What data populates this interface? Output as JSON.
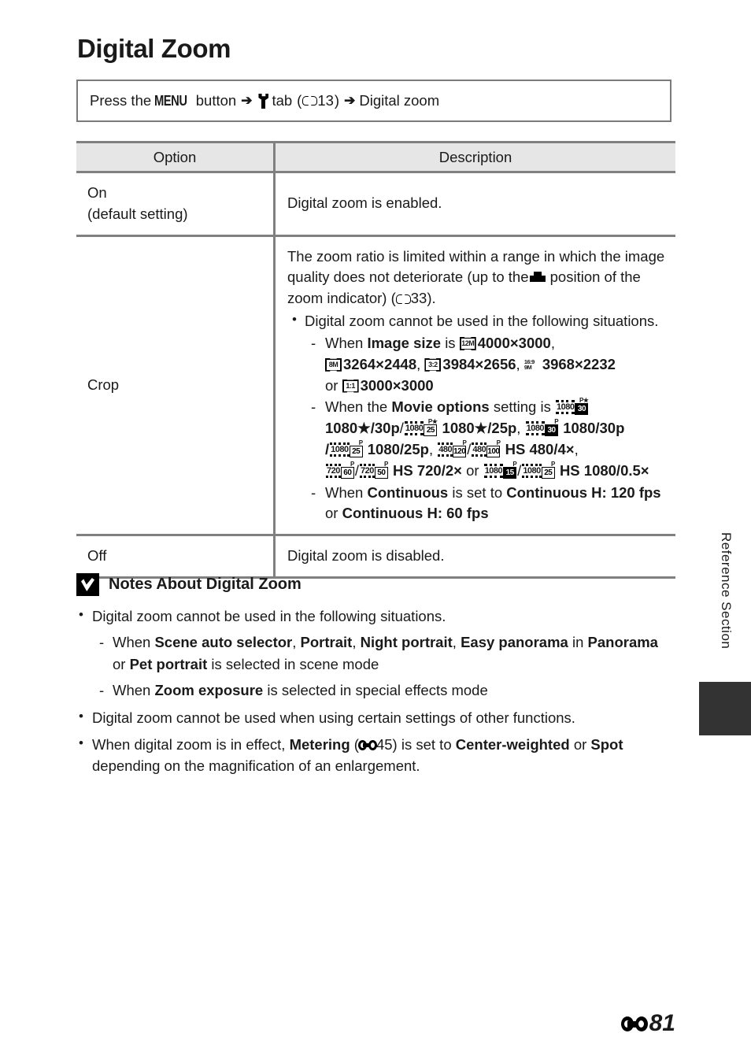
{
  "page": {
    "title": "Digital Zoom",
    "footer_page_number": "81",
    "side_tab_label": "Reference Section"
  },
  "menu_path": {
    "press_the": "Press the",
    "menu_button_label": "MENU",
    "button_word": "button",
    "tab_word": "tab",
    "tab_ref_page": "13",
    "open_paren": "(",
    "close_paren": ")",
    "destination": "Digital zoom",
    "arrow": "➔"
  },
  "table": {
    "headers": {
      "option": "Option",
      "description": "Description"
    },
    "rows": [
      {
        "option_line1": "On",
        "option_line2": "(default setting)",
        "description": "Digital zoom is enabled."
      },
      {
        "option": "Crop",
        "intro_part1": "The zoom ratio is limited within a range in which the image quality does not deteriorate (up to the",
        "intro_part2": "position of the zoom indicator) (",
        "intro_ref_page": "33",
        "intro_part3": ").",
        "bullet": "Digital zoom cannot be used in the following situations.",
        "sub_items": [
          {
            "prefix": "When",
            "bold_term": "Image size",
            "mid": "is",
            "sizes": [
              {
                "icon": "12M",
                "value": "4000×3000"
              },
              {
                "icon": "8M",
                "value": "3264×2448"
              },
              {
                "icon": "3:2",
                "value": "3984×2656"
              },
              {
                "icon": "16:9 9M",
                "value": "3968×2232"
              },
              {
                "icon": "1:1",
                "value": "3000×3000"
              }
            ],
            "or_word": "or"
          },
          {
            "prefix": "When the",
            "bold_term": "Movie options",
            "mid": "setting is",
            "movie_modes": [
              {
                "icon_num": "1080",
                "icon_badge": "30",
                "icon_sup": "P★",
                "badge_inverse": false,
                "label": "1080★/30p"
              },
              {
                "icon_num": "1080",
                "icon_badge": "25",
                "icon_sup": "P★",
                "badge_inverse": true,
                "label": "1080★/25p"
              },
              {
                "icon_num": "1080",
                "icon_badge": "30",
                "icon_sup": "P",
                "badge_inverse": false,
                "label": "1080/30p"
              },
              {
                "icon_num": "1080",
                "icon_badge": "25",
                "icon_sup": "P",
                "badge_inverse": true,
                "label": "1080/25p"
              },
              {
                "icon_num": "480",
                "icon_badge": "120",
                "icon_sup": "P",
                "badge_inverse": true,
                "label": ""
              },
              {
                "icon_num": "480",
                "icon_badge": "100",
                "icon_sup": "P",
                "badge_inverse": true,
                "label": "HS 480/4×"
              },
              {
                "icon_num": "720",
                "icon_badge": "60",
                "icon_sup": "P",
                "badge_inverse": true,
                "label": ""
              },
              {
                "icon_num": "720",
                "icon_badge": "50",
                "icon_sup": "P",
                "badge_inverse": true,
                "label": "HS 720/2×"
              },
              {
                "icon_num": "1080",
                "icon_badge": "15",
                "icon_sup": "P",
                "badge_inverse": false,
                "label": ""
              },
              {
                "icon_num": "1080",
                "icon_badge": "25",
                "icon_sup": "P",
                "badge_inverse": true,
                "label": "HS 1080/0.5×"
              }
            ],
            "or_word": "or"
          },
          {
            "prefix": "When",
            "bold_term": "Continuous",
            "mid": "is set to",
            "value_a": "Continuous H: 120 fps",
            "or_word": "or",
            "value_b": "Continuous H: 60 fps"
          }
        ]
      },
      {
        "option": "Off",
        "description": "Digital zoom is disabled."
      }
    ]
  },
  "notes": {
    "heading": "Notes About Digital Zoom",
    "items": [
      {
        "type": "bullet",
        "text": "Digital zoom cannot be used in the following situations."
      },
      {
        "type": "dash",
        "prefix": "When",
        "bold_1": "Scene auto selector",
        "sep_1": ",",
        "bold_2": "Portrait",
        "sep_2": ",",
        "bold_3": "Night portrait",
        "sep_3": ",",
        "bold_4": "Easy panorama",
        "mid": "in",
        "bold_5": "Panorama",
        "or_word": "or",
        "bold_6": "Pet portrait",
        "suffix": "is selected in scene mode"
      },
      {
        "type": "dash",
        "prefix": "When",
        "bold_1": "Zoom exposure",
        "suffix": "is selected in special effects mode"
      },
      {
        "type": "bullet",
        "text": "Digital zoom cannot be used when using certain settings of other functions."
      },
      {
        "type": "bullet_rich",
        "part1": "When digital zoom is in effect,",
        "bold_1": "Metering",
        "paren_open": "(",
        "ref_page": "45",
        "paren_close": ")",
        "part2": "is set to",
        "bold_2": "Center-weighted",
        "or_word": "or",
        "bold_3": "Spot",
        "part3": "depending on the magnification of an enlargement."
      }
    ]
  },
  "colors": {
    "table_header_bg": "#e6e6e6",
    "rule": "#808080",
    "box_border": "#7a7a7a",
    "side_tab": "#333333",
    "text": "#1a1a1a"
  }
}
